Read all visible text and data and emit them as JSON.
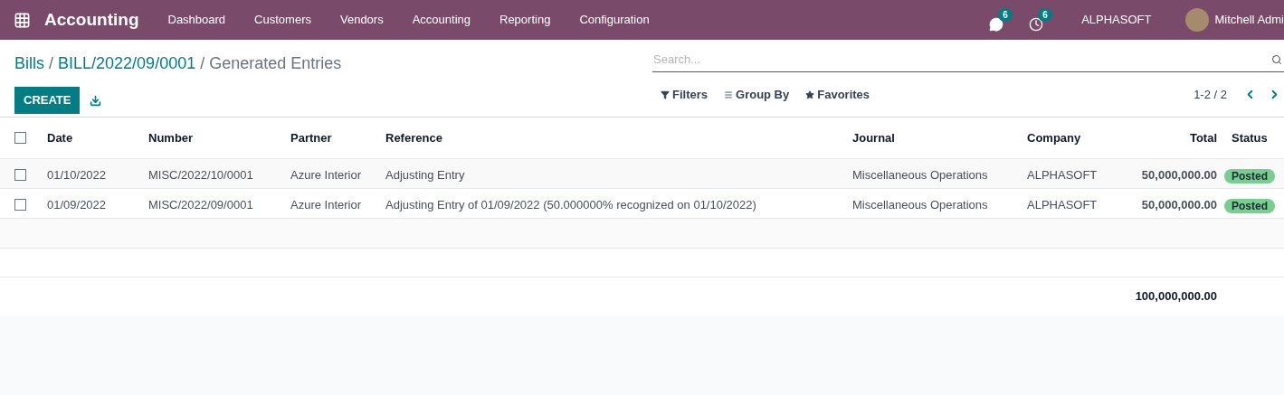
{
  "navbar": {
    "app_title": "Accounting",
    "menu": [
      "Dashboard",
      "Customers",
      "Vendors",
      "Accounting",
      "Reporting",
      "Configuration"
    ],
    "messages_badge": "6",
    "activities_badge": "6",
    "company": "ALPHASOFT",
    "user": "Mitchell Admi"
  },
  "breadcrumb": {
    "links": [
      "Bills",
      "BILL/2022/09/0001"
    ],
    "separator": "/",
    "current": "Generated Entries"
  },
  "create_button": "CREATE",
  "search": {
    "placeholder": "Search..."
  },
  "filters": [
    "Filters",
    "Group By",
    "Favorites"
  ],
  "pager": "1-2 / 2",
  "table": {
    "select_all_checked": false,
    "columns": [
      "Date",
      "Number",
      "Partner",
      "Reference",
      "Journal",
      "Company",
      "Total",
      "Status"
    ],
    "rows": [
      {
        "checked": false,
        "cells": [
          "01/10/2022",
          "MISC/2022/10/0001",
          "Azure Interior",
          "Adjusting Entry",
          "Miscellaneous Operations",
          "ALPHASOFT",
          "50,000,000.00",
          "Posted"
        ]
      },
      {
        "checked": false,
        "cells": [
          "01/09/2022",
          "MISC/2022/09/0001",
          "Azure Interior",
          "Adjusting Entry of 01/09/2022 (50.000000% recognized on 01/10/2022)",
          "Miscellaneous Operations",
          "ALPHASOFT",
          "50,000,000.00",
          "Posted"
        ]
      }
    ],
    "footer_total": "100,000,000.00"
  }
}
